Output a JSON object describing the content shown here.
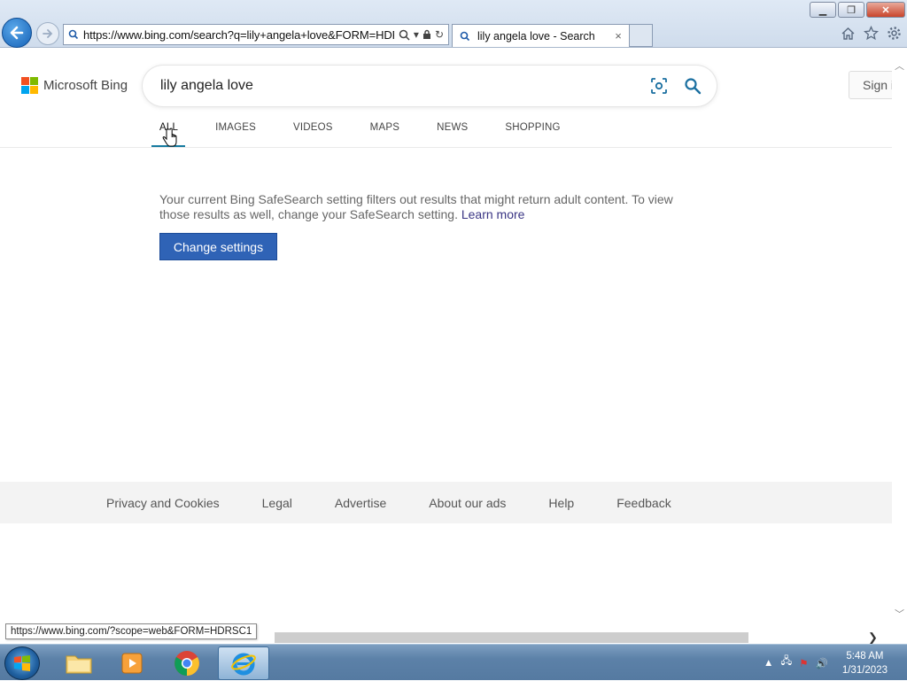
{
  "browser": {
    "address_url": "https://www.bing.com/search?q=lily+angela+love&FORM=HDF",
    "tab_title": "lily angela love - Search",
    "tab_close": "×"
  },
  "bing": {
    "logo_text": "Microsoft Bing",
    "query": "lily angela love",
    "signin": "Sign i",
    "tabs": [
      {
        "label": "ALL",
        "active": true
      },
      {
        "label": "IMAGES"
      },
      {
        "label": "VIDEOS"
      },
      {
        "label": "MAPS"
      },
      {
        "label": "NEWS"
      },
      {
        "label": "SHOPPING"
      }
    ],
    "safesearch_message": "Your current Bing SafeSearch setting filters out results that might return adult content. To view those results as well, change your SafeSearch setting.",
    "learn_more": "Learn more",
    "change_settings": "Change settings",
    "footer": [
      "Privacy and Cookies",
      "Legal",
      "Advertise",
      "About our ads",
      "Help",
      "Feedback"
    ]
  },
  "status_url": "https://www.bing.com/?scope=web&FORM=HDRSC1",
  "taskbar": {
    "time": "5:48 AM",
    "date": "1/31/2023"
  },
  "colors": {
    "bing_accent": "#167ba0",
    "button_blue": "#2f63b6",
    "link_purple": "#3a3584"
  }
}
